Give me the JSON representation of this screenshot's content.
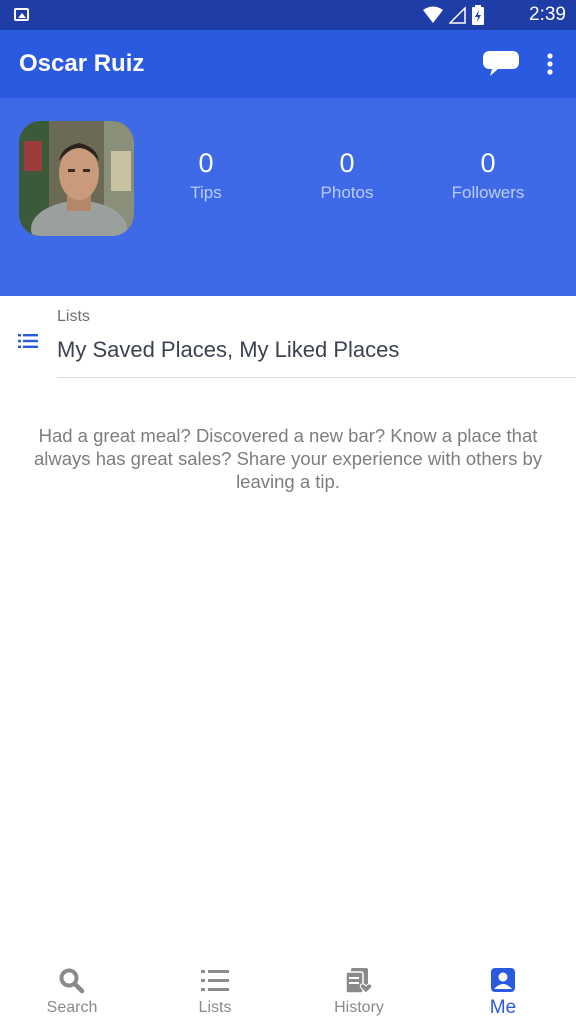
{
  "status_bar": {
    "time": "2:39"
  },
  "app_bar": {
    "title": "Oscar Ruiz",
    "chat_icon": "chat-bubble-icon",
    "more_icon": "more-vert-icon"
  },
  "profile": {
    "stats": [
      {
        "value": "0",
        "label": "Tips"
      },
      {
        "value": "0",
        "label": "Photos"
      },
      {
        "value": "0",
        "label": "Followers"
      }
    ]
  },
  "lists": {
    "caption": "Lists",
    "value": "My Saved Places, My Liked Places"
  },
  "empty_tip": "Had a great meal? Discovered a new bar? Know a place that always has great sales? Share your experience with others by leaving a tip.",
  "bottom_nav": [
    {
      "label": "Search",
      "icon": "search-icon"
    },
    {
      "label": "Lists",
      "icon": "list-icon"
    },
    {
      "label": "History",
      "icon": "history-icon"
    },
    {
      "label": "Me",
      "icon": "profile-icon",
      "active": true
    }
  ],
  "colors": {
    "primary": "#2a5ae0",
    "header": "#3e6ae8",
    "status_bar": "#1e3da6"
  }
}
